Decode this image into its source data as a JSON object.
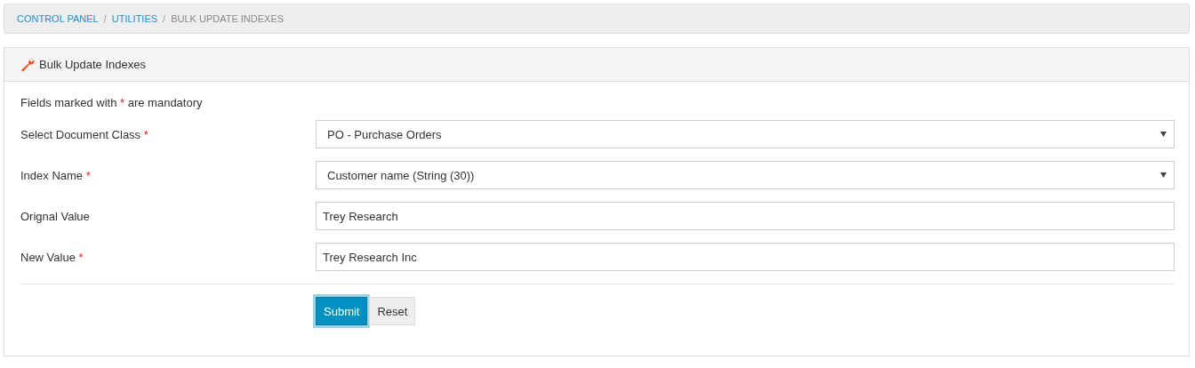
{
  "breadcrumb": {
    "separator": "/",
    "items": [
      {
        "label": "CONTROL PANEL",
        "current": false
      },
      {
        "label": "UTILITIES",
        "current": false
      },
      {
        "label": "BULK UPDATE INDEXES",
        "current": true
      }
    ]
  },
  "panel": {
    "title": "Bulk Update Indexes"
  },
  "required_mark": "*",
  "note": {
    "before": "Fields marked with",
    "after": "are mandatory"
  },
  "fields": [
    {
      "kind": "select",
      "label": "Select Document Class",
      "required": true,
      "value": "PO - Purchase Orders"
    },
    {
      "kind": "select",
      "label": "Index Name",
      "required": true,
      "value": "Customer name (String (30))"
    },
    {
      "kind": "text",
      "label": "Orignal Value",
      "required": false,
      "value": "Trey Research"
    },
    {
      "kind": "text",
      "label": "New Value",
      "required": true,
      "value": "Trey Research Inc"
    }
  ],
  "buttons": [
    {
      "label": "Submit",
      "kind": "primary",
      "focused": true
    },
    {
      "label": "Reset",
      "kind": "default",
      "focused": false
    }
  ]
}
